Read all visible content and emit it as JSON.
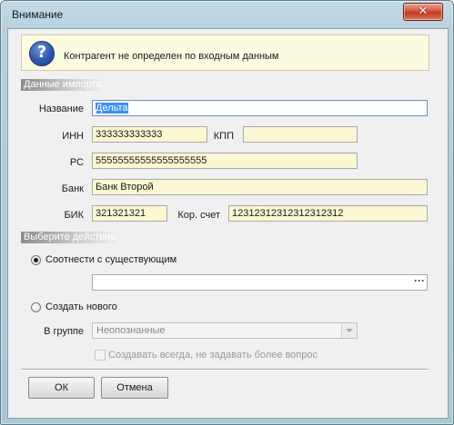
{
  "window": {
    "title": "Внимание",
    "close_symbol": "✕"
  },
  "message": {
    "text": "Контрагент не определен по входным данным",
    "icon": "question-icon",
    "icon_glyph": "?"
  },
  "import_section": {
    "header": "Данные импорта",
    "name_label": "Название",
    "name_value": "Дельта",
    "inn_label": "ИНН",
    "inn_value": "333333333333",
    "kpp_label": "КПП",
    "kpp_value": "",
    "rs_label": "РС",
    "rs_value": "55555555555555555555",
    "bank_label": "Банк",
    "bank_value": "Банк Второй",
    "bik_label": "БИК",
    "bik_value": "321321321",
    "kor_label": "Кор. счет",
    "kor_value": "12312312312312312312"
  },
  "action_section": {
    "header": "Выберите действие",
    "match_label": "Соотнести с существующим",
    "match_selected": true,
    "match_value": "",
    "browse_glyph": "···",
    "create_label": "Создать нового",
    "create_selected": false,
    "group_label": "В группе",
    "group_value": "Неопознанные",
    "always_create_label": "Создавать всегда, не задавать более вопрос",
    "always_create_checked": false
  },
  "buttons": {
    "ok": "ОК",
    "cancel": "Отмена"
  },
  "colors": {
    "field_bg": "#fbf7d3",
    "message_bg": "#fdfbdf",
    "selection": "#3b8ff2",
    "title_gradient": "#b6d0dc",
    "close_red": "#c23a20"
  }
}
